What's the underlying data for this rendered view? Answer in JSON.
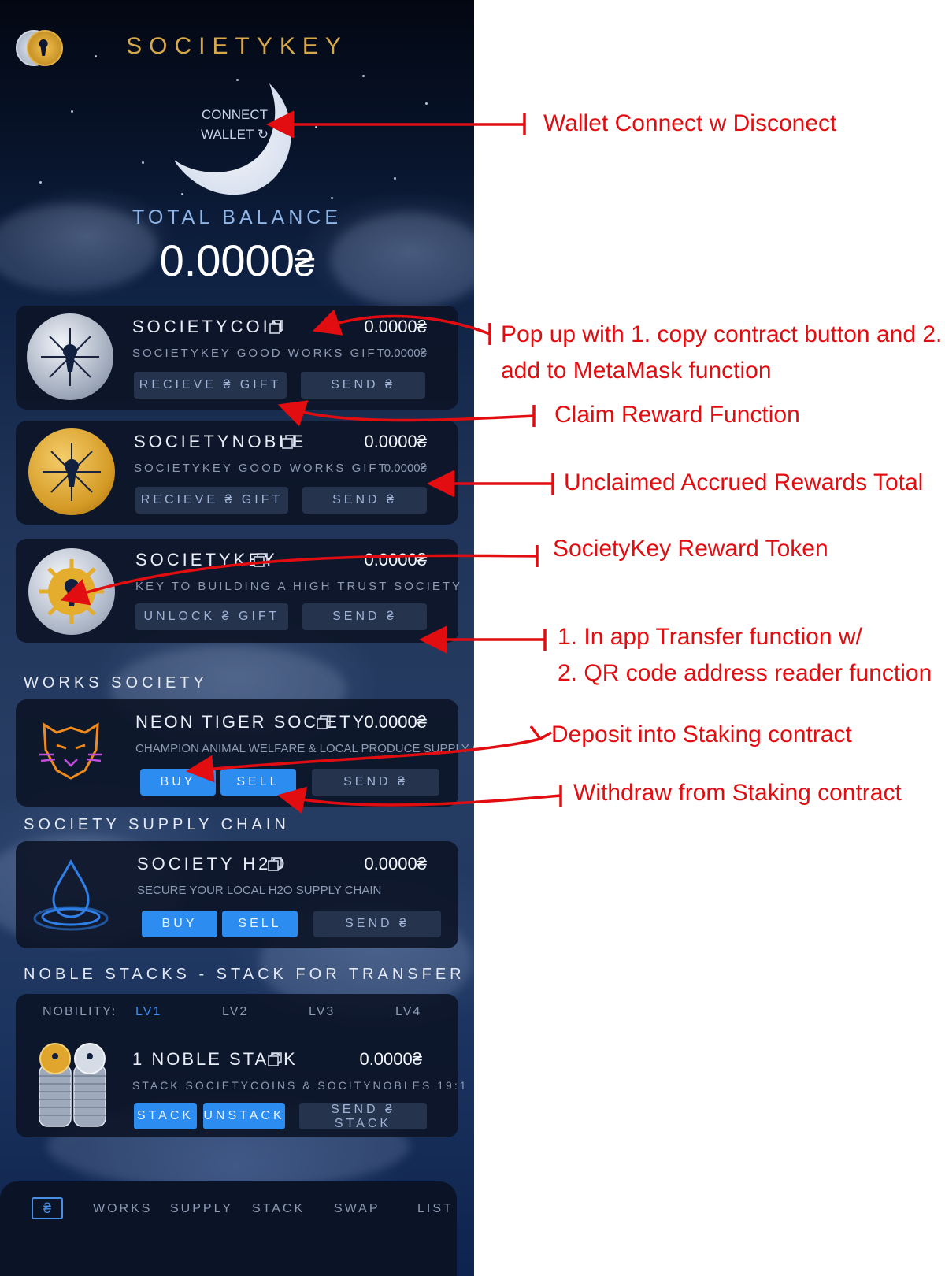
{
  "app": {
    "brand": "SOCIETYKEY",
    "connect_line1": "CONNECT",
    "connect_line2": "WALLET",
    "total_label": "TOTAL BALANCE",
    "total_value": "0.0000",
    "currency_symbol": "₴"
  },
  "tokens": [
    {
      "name": "SOCIETYCOIN",
      "balance": "0.0000",
      "subtitle": "SOCIETYKEY GOOD WORKS GIFT",
      "sub_balance": "0.0000",
      "btn1": "RECIEVE ₴ GIFT",
      "btn2": "SEND ₴"
    },
    {
      "name": "SOCIETYNOBLE",
      "balance": "0.0000",
      "subtitle": "SOCIETYKEY GOOD WORKS GIFT",
      "sub_balance": "0.0000",
      "btn1": "RECIEVE ₴ GIFT",
      "btn2": "SEND ₴"
    },
    {
      "name": "SOCIETYKEY",
      "balance": "0.0000",
      "subtitle": "KEY TO BUILDING A HIGH TRUST SOCIETY",
      "btn1": "UNLOCK ₴ GIFT",
      "btn2": "SEND ₴"
    }
  ],
  "works": {
    "heading": "WORKS SOCIETY",
    "name": "NEON TIGER SOCIETY",
    "balance": "0.0000",
    "subtitle": "CHAMPION ANIMAL WELFARE & LOCAL PRODUCE SUPPLY CHAIN",
    "buy": "BUY",
    "sell": "SELL",
    "send": "SEND ₴"
  },
  "supply": {
    "heading": "SOCIETY SUPPLY CHAIN",
    "name": "SOCIETY H2O",
    "balance": "0.0000",
    "subtitle": "SECURE YOUR LOCAL H2O SUPPLY CHAIN",
    "buy": "BUY",
    "sell": "SELL",
    "send": "SEND ₴"
  },
  "stacks": {
    "heading": "NOBLE STACKS - STACK FOR TRANSFER",
    "nobility_label": "NOBILITY:",
    "levels": [
      "LV1",
      "LV2",
      "LV3",
      "LV4"
    ],
    "name": "1 NOBLE STACK",
    "balance": "0.0000",
    "subtitle": "STACK SOCIETYCOINS & SOCITYNOBLES 19:1",
    "stack": "STACK",
    "unstack": "UNSTACK",
    "send": "SEND ₴ STACK"
  },
  "nav": {
    "home_icon": "₴",
    "items": [
      "WORKS",
      "SUPPLY",
      "STACK",
      "SWAP",
      "LIST"
    ]
  },
  "annotations": {
    "a1": "Wallet Connect w Disconect",
    "a2_line1": "Pop up with 1. copy contract button and 2.",
    "a2_line2": "add to MetaMask function",
    "a3": "Claim Reward Function",
    "a4": "Unclaimed Accrued Rewards Total",
    "a5": "SocietyKey Reward Token",
    "a6_line1": "1. In app Transfer function w/",
    "a6_line2": "2. QR code address reader function",
    "a7": "Deposit into Staking contract",
    "a8": "Withdraw from Staking contract"
  },
  "colors": {
    "annotation_red": "#e10d10",
    "brand_gold": "#d7a94a",
    "button_blue": "#2d8cf0",
    "balance_label": "#8fb6e8"
  }
}
